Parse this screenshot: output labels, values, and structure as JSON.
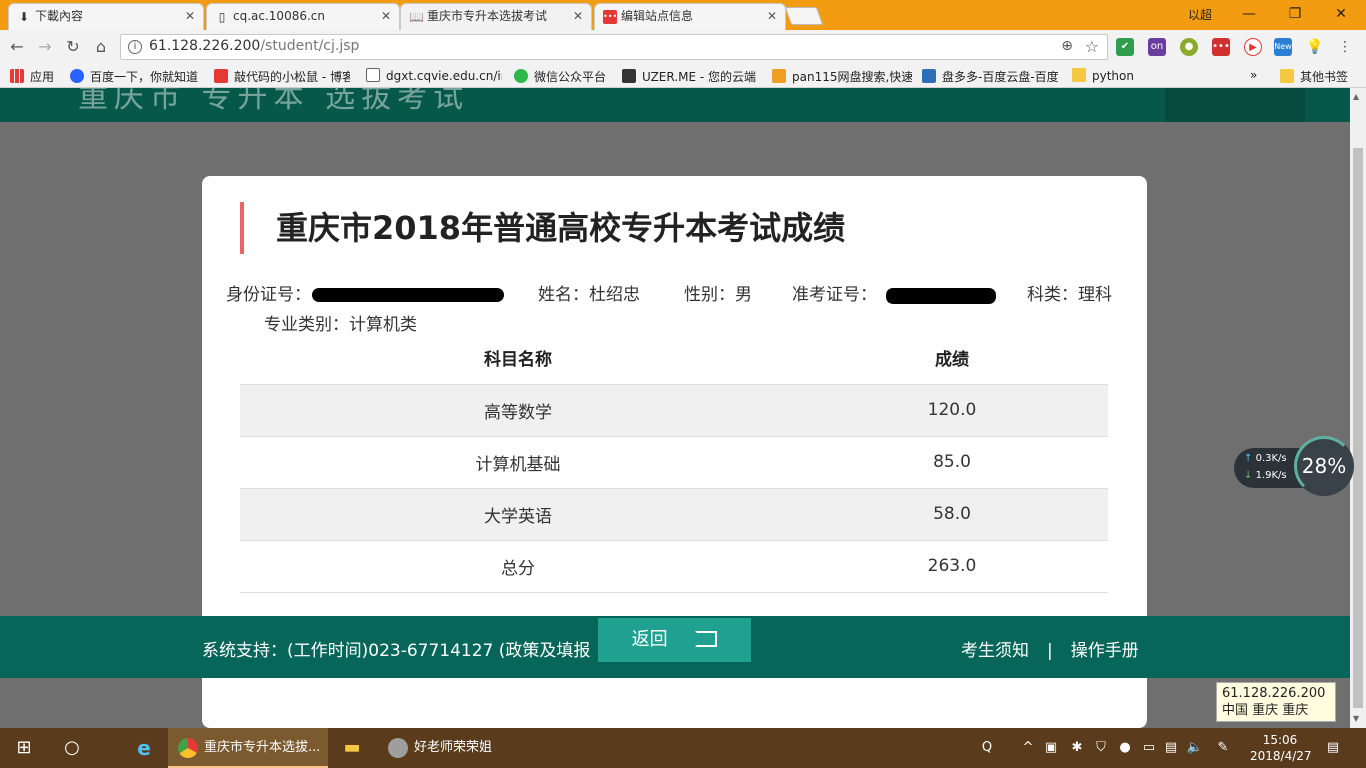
{
  "browser": {
    "tabs": [
      {
        "title": "下載內容",
        "icon": "download-icon"
      },
      {
        "title": "cq.ac.10086.cn",
        "icon": "page-icon"
      },
      {
        "title": "重庆市专升本选拔考试",
        "icon": "book-icon"
      },
      {
        "title": "编辑站点信息",
        "icon": "site-icon"
      }
    ],
    "user": "以超",
    "url_host": "61.128.226.200",
    "url_path": "/student/cj.jsp",
    "bookmarks": [
      "应用",
      "百度一下，你就知道",
      "敲代码的小松鼠 - 博客",
      "dgxt.cqvie.edu.cn/in",
      "微信公众平台",
      "UZER.ME - 您的云端",
      "pan115网盘搜索,快速",
      "盘多多-百度云盘-百度",
      "python",
      "其他书签"
    ],
    "more_bookmarks": "»",
    "ext_badges": {
      "on": "on",
      "new": "New"
    }
  },
  "site": {
    "header_title": "重庆市  专升本  选拔考试"
  },
  "card": {
    "title": "重庆市2018年普通高校专升本考试成绩",
    "id_label": "身份证号：",
    "name": "姓名：杜绍忠",
    "gender": "性别：男",
    "ticket_label": "准考证号：",
    "category": "科类：理科",
    "major": "专业类别：计算机类"
  },
  "table": {
    "headers": [
      "科目名称",
      "成绩"
    ],
    "rows": [
      [
        "高等数学",
        "120.0"
      ],
      [
        "计算机基础",
        "85.0"
      ],
      [
        "大学英语",
        "58.0"
      ],
      [
        "总分",
        "263.0"
      ]
    ]
  },
  "footer": {
    "support": "系统支持：(工作时间)023-67714127  (政策及填报",
    "back": "返回",
    "notice": "考生须知",
    "sep": "|",
    "manual": "操作手册"
  },
  "net": {
    "up": "0.3K/s",
    "down": "1.9K/s",
    "percent": "28%"
  },
  "ip_tip": {
    "ip": "61.128.226.200",
    "location": "中国 重庆 重庆"
  },
  "taskbar": {
    "chrome_task": "重庆市专升本选拔...",
    "other_task": "好老师荣荣姐",
    "time": "15:06",
    "date": "2018/4/27"
  }
}
